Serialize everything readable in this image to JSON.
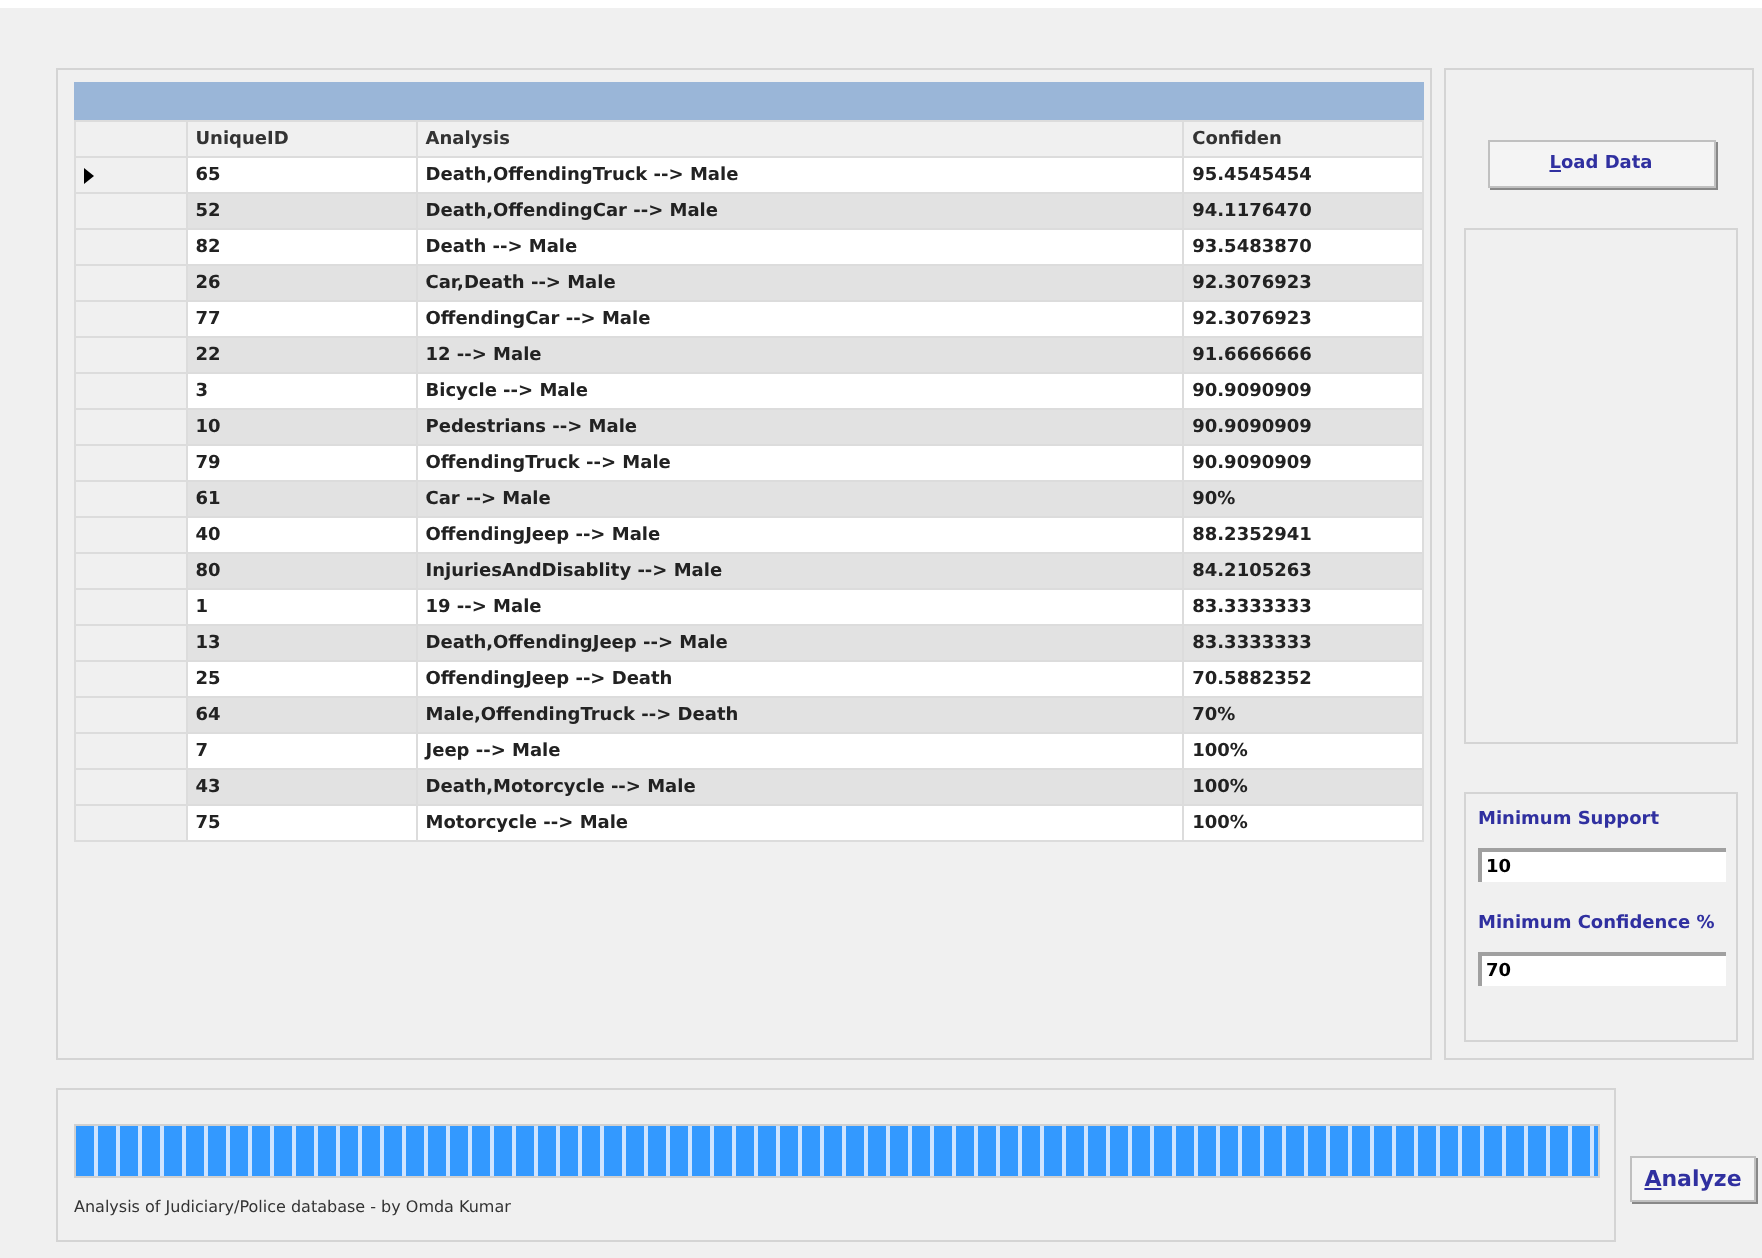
{
  "grid": {
    "columns": [
      "UniqueID",
      "Analysis",
      "Confiden"
    ],
    "rows": [
      {
        "cells": [
          "65",
          "Death,OffendingTruck --> Male",
          "95.4545454"
        ],
        "selected": true
      },
      {
        "cells": [
          "52",
          "Death,OffendingCar --> Male",
          "94.1176470"
        ],
        "selected": false
      },
      {
        "cells": [
          "82",
          "Death --> Male",
          "93.5483870"
        ],
        "selected": false
      },
      {
        "cells": [
          "26",
          "Car,Death --> Male",
          "92.3076923"
        ],
        "selected": false
      },
      {
        "cells": [
          "77",
          "OffendingCar --> Male",
          "92.3076923"
        ],
        "selected": false
      },
      {
        "cells": [
          "22",
          "12 --> Male",
          "91.6666666"
        ],
        "selected": false
      },
      {
        "cells": [
          "3",
          "Bicycle --> Male",
          "90.9090909"
        ],
        "selected": false
      },
      {
        "cells": [
          "10",
          "Pedestrians --> Male",
          "90.9090909"
        ],
        "selected": false
      },
      {
        "cells": [
          "79",
          "OffendingTruck --> Male",
          "90.9090909"
        ],
        "selected": false
      },
      {
        "cells": [
          "61",
          "Car --> Male",
          "90%"
        ],
        "selected": false
      },
      {
        "cells": [
          "40",
          "OffendingJeep --> Male",
          "88.2352941"
        ],
        "selected": false
      },
      {
        "cells": [
          "80",
          "InjuriesAndDisablity --> Male",
          "84.2105263"
        ],
        "selected": false
      },
      {
        "cells": [
          "1",
          "19 --> Male",
          "83.3333333"
        ],
        "selected": false
      },
      {
        "cells": [
          "13",
          "Death,OffendingJeep --> Male",
          "83.3333333"
        ],
        "selected": false
      },
      {
        "cells": [
          "25",
          "OffendingJeep --> Death",
          "70.5882352"
        ],
        "selected": false
      },
      {
        "cells": [
          "64",
          "Male,OffendingTruck --> Death",
          "70%"
        ],
        "selected": false
      },
      {
        "cells": [
          "7",
          "Jeep --> Male",
          "100%"
        ],
        "selected": false
      },
      {
        "cells": [
          "43",
          "Death,Motorcycle --> Male",
          "100%"
        ],
        "selected": false
      },
      {
        "cells": [
          "75",
          "Motorcycle --> Male",
          "100%"
        ],
        "selected": false
      }
    ]
  },
  "load_button": "Load Data",
  "settings": [
    {
      "label": "Minimum Support",
      "value": "10"
    },
    {
      "label": "Minimum Confidence %",
      "value": "70"
    }
  ],
  "progress": {
    "level": 1.0
  },
  "status": "Analysis of Judiciary/Police database - by Omda Kumar",
  "analyze_button": "Analyze"
}
